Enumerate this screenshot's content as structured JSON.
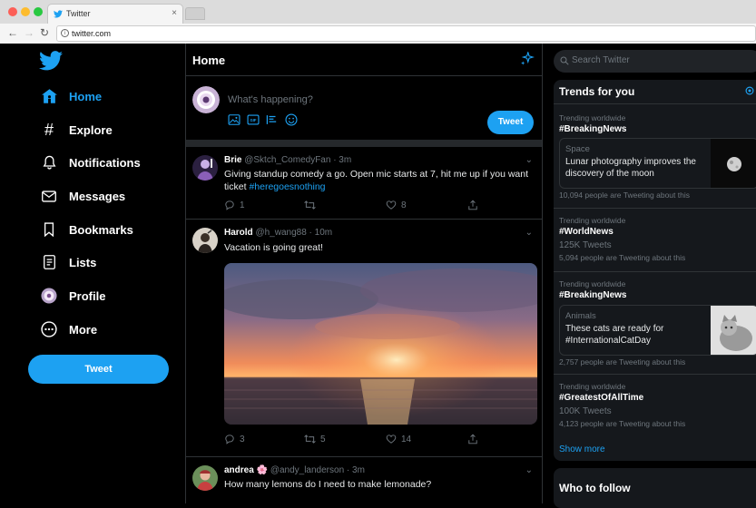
{
  "browser": {
    "tab_title": "Twitter",
    "tab_close": "×",
    "url": "twitter.com"
  },
  "sidebar": {
    "items": [
      {
        "label": "Home",
        "icon": "home-icon",
        "active": true
      },
      {
        "label": "Explore",
        "icon": "hashtag-icon"
      },
      {
        "label": "Notifications",
        "icon": "bell-icon"
      },
      {
        "label": "Messages",
        "icon": "envelope-icon"
      },
      {
        "label": "Bookmarks",
        "icon": "bookmark-icon"
      },
      {
        "label": "Lists",
        "icon": "list-icon"
      },
      {
        "label": "Profile",
        "icon": "avatar-icon"
      },
      {
        "label": "More",
        "icon": "more-icon"
      }
    ],
    "tweet_button": "Tweet"
  },
  "main": {
    "title": "Home",
    "compose": {
      "placeholder": "What's happening?",
      "button": "Tweet"
    },
    "tweets": [
      {
        "name": "Brie",
        "handle": "@Sktch_ComedyFan · 3m",
        "text": "Giving standup comedy a go. Open mic starts at 7, hit me up if you want ticket ",
        "hashtag": "#heregoesnothing",
        "replies": "1",
        "retweets": "",
        "likes": "8"
      },
      {
        "name": "Harold",
        "handle": "@h_wang88 · 10m",
        "text": "Vacation is going great!",
        "replies": "3",
        "retweets": "5",
        "likes": "14"
      },
      {
        "name": "andrea",
        "flower": "🌸",
        "handle": "@andy_landerson · 3m",
        "text": "How many lemons do I need to make lemonade?"
      }
    ]
  },
  "right": {
    "search_placeholder": "Search Twitter",
    "trends_title": "Trends for you",
    "trends": [
      {
        "category": "Trending worldwide",
        "tag": "#BreakingNews"
      },
      {
        "card_category": "Space",
        "card_text": "Lunar photography improves the discovery of the moon",
        "count": "10,094 people are Tweeting about this"
      },
      {
        "category": "Trending worldwide",
        "tag": "#WorldNews",
        "tweets": "125K Tweets",
        "count": "5,094 people are Tweeting about this"
      },
      {
        "category": "Trending worldwide",
        "tag": "#BreakingNews"
      },
      {
        "card_category": "Animals",
        "card_text": "These cats are ready for #InternationalCatDay",
        "count": "2,757 people are Tweeting about this"
      },
      {
        "category": "Trending worldwide",
        "tag": "#GreatestOfAllTime",
        "tweets": "100K Tweets",
        "count": "4,123 people are Tweeting about this"
      }
    ],
    "show_more": "Show more",
    "who_to_follow": "Who to follow"
  },
  "colors": {
    "accent": "#1da1f2",
    "background": "#000000",
    "panel": "#15181c"
  }
}
